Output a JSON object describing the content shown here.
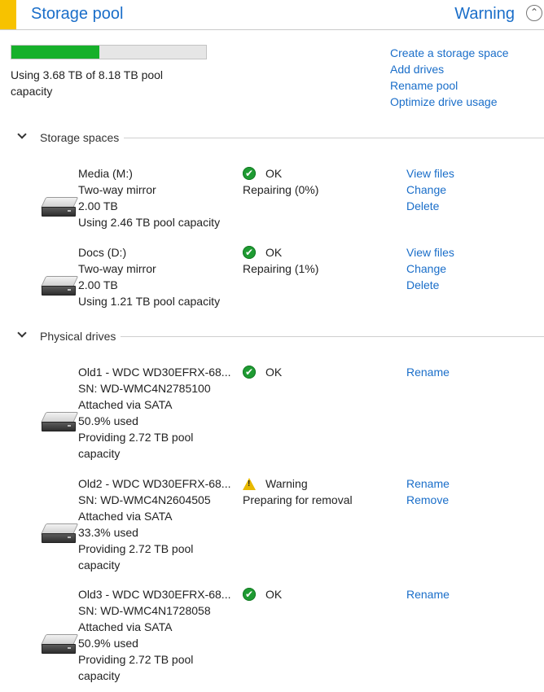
{
  "header": {
    "title": "Storage pool",
    "status": "Warning",
    "collapse_icon": "chevron-up-icon"
  },
  "pool": {
    "usage_fraction": 0.45,
    "usage_text": "Using 3.68 TB of 8.18 TB pool capacity",
    "fill_color": "#16b02a"
  },
  "pool_actions": {
    "create_space": "Create a storage space",
    "add_drives": "Add drives",
    "rename_pool": "Rename pool",
    "optimize": "Optimize drive usage"
  },
  "storage_spaces": {
    "label": "Storage spaces",
    "items": [
      {
        "name": "Media (M:)",
        "resiliency": "Two-way mirror",
        "size": "2.00 TB",
        "usage": "Using 2.46 TB pool capacity",
        "status": "OK",
        "status_detail": "Repairing (0%)",
        "action_view": "View files",
        "action_change": "Change",
        "action_delete": "Delete"
      },
      {
        "name": "Docs (D:)",
        "resiliency": "Two-way mirror",
        "size": "2.00 TB",
        "usage": "Using 1.21 TB pool capacity",
        "status": "OK",
        "status_detail": "Repairing (1%)",
        "action_view": "View files",
        "action_change": "Change",
        "action_delete": "Delete"
      }
    ]
  },
  "physical_drives": {
    "label": "Physical drives",
    "items": [
      {
        "name": "Old1 - WDC WD30EFRX-68...",
        "serial": "SN: WD-WMC4N2785100",
        "attach": "Attached via SATA",
        "used": "50.9% used",
        "provide_1": "Providing 2.72 TB pool",
        "provide_2": "capacity",
        "status": "OK",
        "status_icon": "ok-check-icon",
        "action_rename": "Rename"
      },
      {
        "name": "Old2 - WDC WD30EFRX-68...",
        "serial": "SN: WD-WMC4N2604505",
        "attach": "Attached via SATA",
        "used": "33.3% used",
        "provide_1": "Providing 2.72 TB pool",
        "provide_2": "capacity",
        "status": "Warning",
        "status_icon": "warning-triangle-icon",
        "status_detail": "Preparing for removal",
        "action_rename": "Rename",
        "action_remove": "Remove"
      },
      {
        "name": "Old3 - WDC WD30EFRX-68...",
        "serial": "SN: WD-WMC4N1728058",
        "attach": "Attached via SATA",
        "used": "50.9% used",
        "provide_1": "Providing 2.72 TB pool",
        "provide_2": "capacity",
        "status": "OK",
        "status_icon": "ok-check-icon",
        "action_rename": "Rename"
      }
    ]
  }
}
